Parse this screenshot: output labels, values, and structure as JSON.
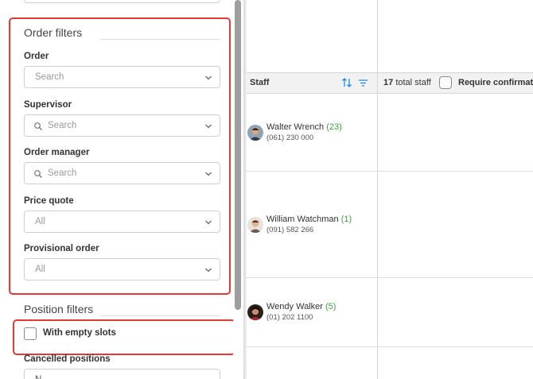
{
  "order_filters": {
    "title": "Order filters",
    "fields": [
      {
        "label": "Order",
        "placeholder": "Search",
        "has_search_icon": false
      },
      {
        "label": "Supervisor",
        "placeholder": "Search",
        "has_search_icon": true
      },
      {
        "label": "Order manager",
        "placeholder": "Search",
        "has_search_icon": true
      },
      {
        "label": "Price quote",
        "placeholder": "All",
        "has_search_icon": false
      },
      {
        "label": "Provisional order",
        "placeholder": "All",
        "has_search_icon": false
      }
    ]
  },
  "position_filters": {
    "title": "Position filters",
    "empty_slots_label": "With empty slots",
    "cancelled_label": "Cancelled positions",
    "cancelled_value_partial": "N"
  },
  "staff_grid": {
    "header": {
      "staff_label": "Staff",
      "total_count": "17",
      "total_suffix": "total staff",
      "require_confirmation_label": "Require confirmatio"
    },
    "rows": [
      {
        "name": "Walter Wrench",
        "count_text": "(23)",
        "count_number": "23",
        "phone": "(061) 230 000"
      },
      {
        "name": "William Watchman",
        "count_text": "(1)",
        "count_number": "1",
        "phone": "(091) 582 266"
      },
      {
        "name": "Wendy Walker",
        "count_text": "(5)",
        "count_number": "5",
        "phone": "(01) 202 1100"
      }
    ]
  },
  "colors": {
    "highlight": "#e53935",
    "count_green": "#43a047",
    "sort_icon_blue": "#1e88e5"
  },
  "icons": [
    "search-icon",
    "chevron-down-icon",
    "sort-icon",
    "filter-icon"
  ]
}
